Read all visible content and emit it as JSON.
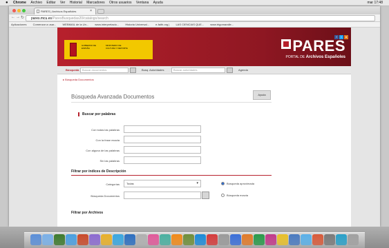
{
  "menubar": {
    "app": "Chrome",
    "items": [
      "Archivo",
      "Editar",
      "Ver",
      "Historial",
      "Marcadores",
      "Otros usuarios",
      "Ventana",
      "Ayuda"
    ],
    "status": "mar 17:48"
  },
  "browser": {
    "tab_title": "PARES | Archivos Españoles",
    "url_host": "pares.mcu.es",
    "url_path": "/ParesBusquedas20/catalogo/search",
    "bookmarks": [
      "Aplicaciones",
      "Comenzar a usar...",
      "WEBMAIL de la Un...",
      "www.interpretacio...",
      "Historia Universal...",
      "e-faith.org |",
      "LAS CIENCIAS QUE...",
      "www.trigomaralle..."
    ]
  },
  "header": {
    "logo_title": "PARES",
    "logo_subtitle_prefix": "PORTAL DE",
    "logo_subtitle": "Archivos Españoles",
    "gob_text1": "GOBIERNO DE ESPAÑA",
    "gob_text2": "MINISTERIO DE CULTURA Y DEPORTE"
  },
  "searchbar": {
    "label_docs": "Búsqueda",
    "placeholder_docs": "Buscar documentos",
    "label_auth": "Busq. Autoridades",
    "placeholder_auth": "Buscar autoridades",
    "agenda": "Agenda"
  },
  "breadcrumb": "Búsqueda Documentos",
  "page_title": "Búsqueda Avanzada Documentos",
  "help_button": "Ayuda",
  "section_words": {
    "title": "Buscar por palabras",
    "fields": [
      "Con todas las palabras",
      "Con la frase exacta",
      "Con alguna de las palabras",
      "Sin las palabras"
    ]
  },
  "section_indices": {
    "title": "Filtrar por índices de Descripción",
    "category_label": "Categorías",
    "category_value": "Todas",
    "search_label": "Búsqueda Documentos",
    "radio_approx": "Búsqueda aproximada",
    "radio_exact": "Búsqueda exacta"
  },
  "section_archive": {
    "title": "Filtrar por Archivos"
  },
  "dock": {
    "colors": [
      "#5b8fd8",
      "#7ab0e8",
      "#3d7a2e",
      "#4a9fe0",
      "#c94a2a",
      "#8c6bd0",
      "#e8b02a",
      "#3aa7e0",
      "#2d6fc0",
      "#b0b0b0",
      "#e05a9a",
      "#4bb0a0",
      "#f08a1a",
      "#6f8f3a",
      "#1d8bd8",
      "#d43b3b",
      "#9a9a9a",
      "#3b6fd8",
      "#e07a2a",
      "#2a9a4a",
      "#c23a8a",
      "#e8c02a",
      "#4a7ac0",
      "#5ab0e8",
      "#d85a3a",
      "#7a7a7a",
      "#2aa0c8",
      "#a0a0a0"
    ]
  }
}
